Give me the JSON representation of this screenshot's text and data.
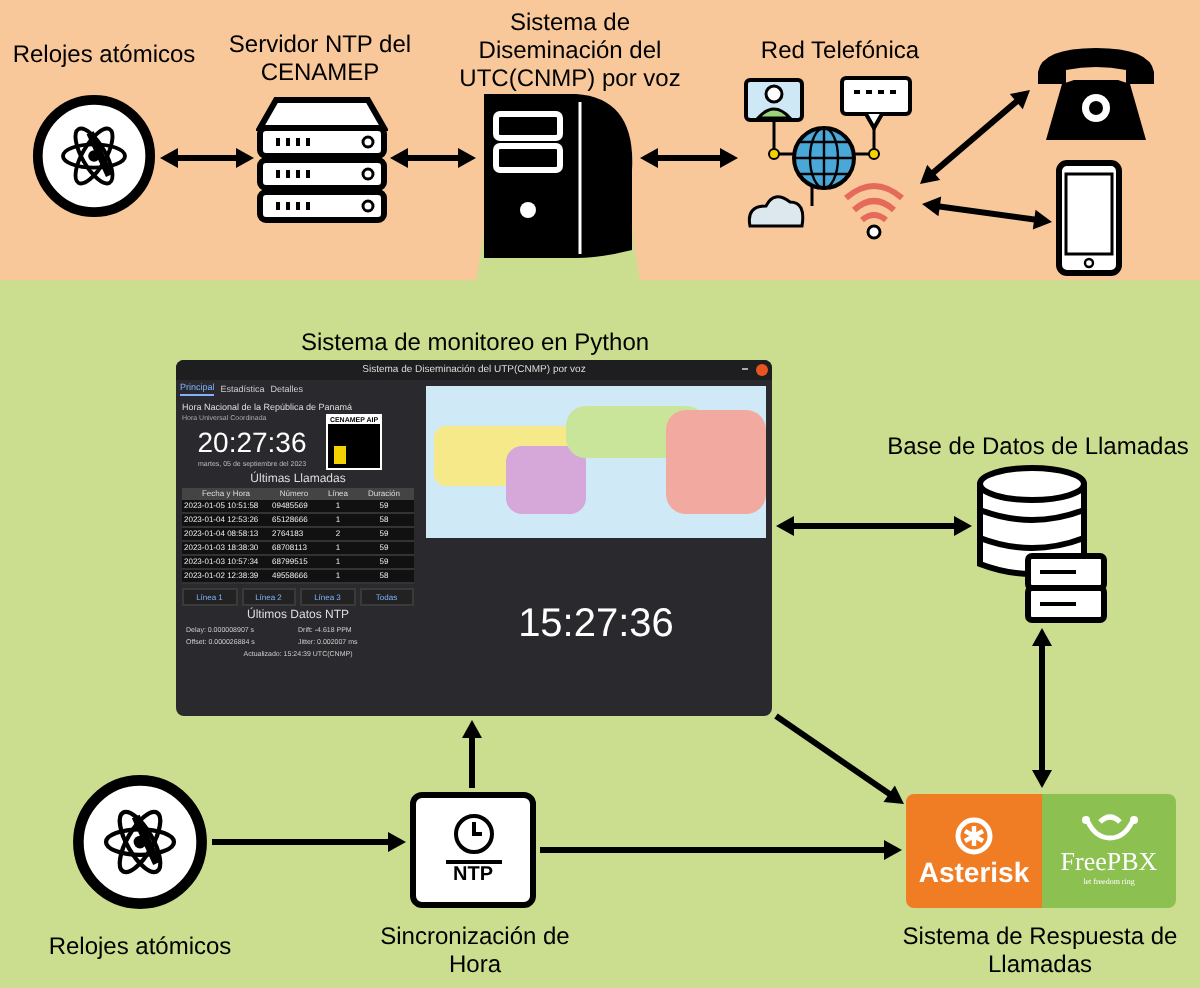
{
  "top_row": {
    "atomic_clocks": {
      "label": "Relojes atómicos"
    },
    "ntp_server": {
      "label": "Servidor NTP del CENAMEP"
    },
    "dissemination_system": {
      "label": "Sistema de Diseminación del UTC(CNMP) por voz"
    },
    "phone_network": {
      "label": "Red Telefónica"
    }
  },
  "monitor": {
    "caption": "Sistema de monitoreo en Python",
    "window": {
      "title": "Sistema de Diseminación del UTP(CNMP) por voz",
      "tabs": [
        {
          "label": "Principal",
          "selected": true
        },
        {
          "label": "Estadística",
          "selected": false
        },
        {
          "label": "Detalles",
          "selected": false
        }
      ],
      "national_time_heading": "Hora Nacional de la República de Panamá",
      "utc_caption": "Hora Universal Coordinada",
      "local_time": "20:27:36",
      "date": "martes, 05 de septiembre del 2023",
      "logo_text": "CENAMEP AIP",
      "calls_heading": "Últimas Llamadas",
      "table": {
        "columns": [
          "Fecha y Hora",
          "Número",
          "Línea",
          "Duración"
        ],
        "rows": [
          [
            "2023-01-05 10:51:58",
            "09485569",
            "1",
            "59"
          ],
          [
            "2023-01-04 12:53:26",
            "65128666",
            "1",
            "58"
          ],
          [
            "2023-01-04 08:58:13",
            "2764183",
            "2",
            "59"
          ],
          [
            "2023-01-03 18:38:30",
            "68708113",
            "1",
            "59"
          ],
          [
            "2023-01-03 10:57:34",
            "68799515",
            "1",
            "59"
          ],
          [
            "2023-01-02 12:38:39",
            "49558666",
            "1",
            "58"
          ]
        ]
      },
      "line_buttons": [
        "Línea 1",
        "Línea 2",
        "Línea 3",
        "Todas"
      ],
      "ntp_heading": "Últimos Datos NTP",
      "ntp_stats": [
        "Delay: 0.000008907 s",
        "Drift: -4.618 PPM",
        "Offset: 0.000026884 s",
        "Jitter: 0.002007 ms"
      ],
      "updated": "Actualizado: 15:24:39 UTC(CNMP)",
      "utc_time": "15:27:36"
    }
  },
  "database": {
    "label": "Base de Datos de Llamadas"
  },
  "bottom_row": {
    "atomic_clocks": {
      "label": "Relojes atómicos"
    },
    "ntp_sync": {
      "box_text": "NTP",
      "label": "Sincronización de Hora"
    },
    "response_system": {
      "label": "Sistema de Respuesta de Llamadas",
      "asterisk_text": "Asterisk",
      "freepbx_text": "FreePBX",
      "freepbx_tagline": "let freedom ring"
    }
  }
}
